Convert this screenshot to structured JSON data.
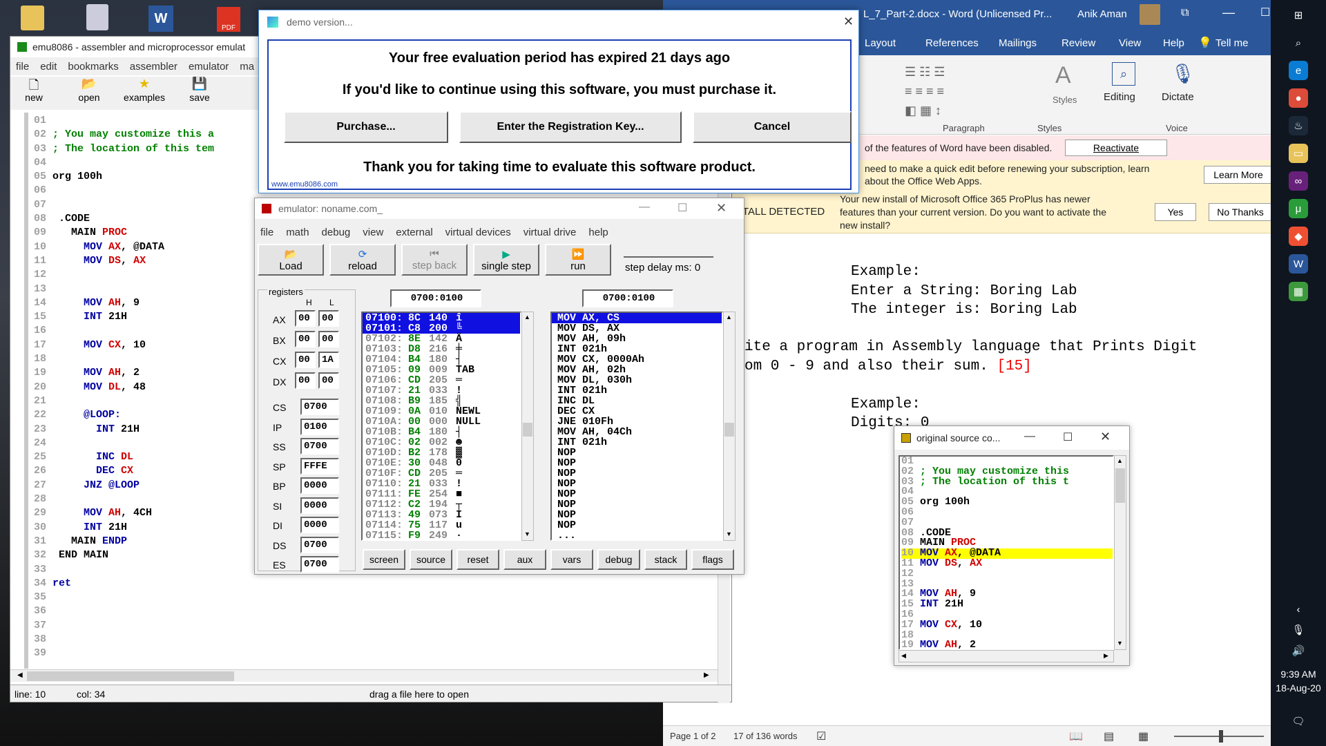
{
  "desktop": {
    "icons": [
      "recycle-bin",
      "word-doc",
      "pdf-file"
    ]
  },
  "word": {
    "title": "L_7_Part-2.docx - Word (Unlicensed Pr...",
    "user": "Anik Aman",
    "menu": [
      "Layout",
      "References",
      "Mailings",
      "Review",
      "View",
      "Help",
      "Tell me"
    ],
    "ribbon": {
      "paragraph": "Paragraph",
      "styles": "Styles",
      "styles_group": "Styles",
      "editing": "Editing",
      "dictate": "Dictate",
      "voice": "Voice"
    },
    "bar1": {
      "text": "of the features of Word have been disabled.",
      "button": "Reactivate"
    },
    "bar2": {
      "text1": "need to make a quick edit before renewing your subscription, learn",
      "text2": "about the Office Web Apps.",
      "button": "Learn More"
    },
    "bar3": {
      "label": "TALL DETECTED",
      "text1": "Your new install of Microsoft Office 365 ProPlus has newer",
      "text2": "features than your current version. Do you want to activate the",
      "text3": "new install?",
      "yes": "Yes",
      "no": "No Thanks"
    },
    "doc": {
      "l1": "Example:",
      "l2": "Enter a String: Boring Lab",
      "l3": "The integer is: Boring Lab",
      "l4": "ite a program in Assembly language that Prints Digit",
      "l5": "om 0 - 9 and also their sum. ",
      "l5b": "[15]",
      "l6": "Example:",
      "l7": "Digits: 0"
    },
    "status": {
      "page": "Page 1 of 2",
      "words": "17 of 136 words"
    }
  },
  "taskbar": {
    "time": "9:39 AM",
    "date": "18-Aug-20"
  },
  "emu": {
    "title": "emu8086 - assembler and microprocessor emulat",
    "menu": [
      "file",
      "edit",
      "bookmarks",
      "assembler",
      "emulator",
      "ma"
    ],
    "tools": [
      "new",
      "open",
      "examples",
      "save",
      "c"
    ],
    "status": {
      "line": "line: 10",
      "col": "col: 34",
      "drag": "drag a file here to open"
    },
    "code": [
      [
        {
          "t": "01",
          "c": "ln"
        }
      ],
      [
        {
          "t": "02 ",
          "c": "ln"
        },
        {
          "t": "; You may customize this a",
          "c": "cmt"
        }
      ],
      [
        {
          "t": "03 ",
          "c": "ln"
        },
        {
          "t": "; The location of this tem",
          "c": "cmt"
        }
      ],
      [
        {
          "t": "04",
          "c": "ln"
        }
      ],
      [
        {
          "t": "05 ",
          "c": "ln"
        },
        {
          "t": "org 100h",
          "c": "dir"
        }
      ],
      [
        {
          "t": "06",
          "c": "ln"
        }
      ],
      [
        {
          "t": "07",
          "c": "ln"
        }
      ],
      [
        {
          "t": "08 ",
          "c": "ln"
        },
        {
          "t": " .CODE",
          "c": "dir"
        }
      ],
      [
        {
          "t": "09 ",
          "c": "ln"
        },
        {
          "t": "   MAIN ",
          "c": "dir"
        },
        {
          "t": "PROC",
          "c": "reg"
        }
      ],
      [
        {
          "t": "10 ",
          "c": "ln"
        },
        {
          "t": "     MOV ",
          "c": "kw"
        },
        {
          "t": "AX",
          "c": "reg"
        },
        {
          "t": ", @DATA",
          "c": "dir"
        }
      ],
      [
        {
          "t": "11 ",
          "c": "ln"
        },
        {
          "t": "     MOV ",
          "c": "kw"
        },
        {
          "t": "DS",
          "c": "reg"
        },
        {
          "t": ", ",
          "c": "dir"
        },
        {
          "t": "AX",
          "c": "reg"
        }
      ],
      [
        {
          "t": "12",
          "c": "ln"
        }
      ],
      [
        {
          "t": "13",
          "c": "ln"
        }
      ],
      [
        {
          "t": "14 ",
          "c": "ln"
        },
        {
          "t": "     MOV ",
          "c": "kw"
        },
        {
          "t": "AH",
          "c": "reg"
        },
        {
          "t": ", 9",
          "c": "dir"
        }
      ],
      [
        {
          "t": "15 ",
          "c": "ln"
        },
        {
          "t": "     INT ",
          "c": "kw"
        },
        {
          "t": "21H",
          "c": "dir"
        }
      ],
      [
        {
          "t": "16",
          "c": "ln"
        }
      ],
      [
        {
          "t": "17 ",
          "c": "ln"
        },
        {
          "t": "     MOV ",
          "c": "kw"
        },
        {
          "t": "CX",
          "c": "reg"
        },
        {
          "t": ", 10",
          "c": "dir"
        }
      ],
      [
        {
          "t": "18",
          "c": "ln"
        }
      ],
      [
        {
          "t": "19 ",
          "c": "ln"
        },
        {
          "t": "     MOV ",
          "c": "kw"
        },
        {
          "t": "AH",
          "c": "reg"
        },
        {
          "t": ", 2",
          "c": "dir"
        }
      ],
      [
        {
          "t": "20 ",
          "c": "ln"
        },
        {
          "t": "     MOV ",
          "c": "kw"
        },
        {
          "t": "DL",
          "c": "reg"
        },
        {
          "t": ", 48",
          "c": "dir"
        }
      ],
      [
        {
          "t": "21",
          "c": "ln"
        }
      ],
      [
        {
          "t": "22 ",
          "c": "ln"
        },
        {
          "t": "     @LOOP:",
          "c": "kw"
        }
      ],
      [
        {
          "t": "23 ",
          "c": "ln"
        },
        {
          "t": "       INT ",
          "c": "kw"
        },
        {
          "t": "21H",
          "c": "dir"
        }
      ],
      [
        {
          "t": "24",
          "c": "ln"
        }
      ],
      [
        {
          "t": "25 ",
          "c": "ln"
        },
        {
          "t": "       INC ",
          "c": "kw"
        },
        {
          "t": "DL",
          "c": "reg"
        }
      ],
      [
        {
          "t": "26 ",
          "c": "ln"
        },
        {
          "t": "       DEC ",
          "c": "kw"
        },
        {
          "t": "CX",
          "c": "reg"
        }
      ],
      [
        {
          "t": "27 ",
          "c": "ln"
        },
        {
          "t": "     JNZ ",
          "c": "kw"
        },
        {
          "t": "@LOOP",
          "c": "kw"
        }
      ],
      [
        {
          "t": "28",
          "c": "ln"
        }
      ],
      [
        {
          "t": "29 ",
          "c": "ln"
        },
        {
          "t": "     MOV ",
          "c": "kw"
        },
        {
          "t": "AH",
          "c": "reg"
        },
        {
          "t": ", 4CH",
          "c": "dir"
        }
      ],
      [
        {
          "t": "30 ",
          "c": "ln"
        },
        {
          "t": "     INT ",
          "c": "kw"
        },
        {
          "t": "21H",
          "c": "dir"
        }
      ],
      [
        {
          "t": "31 ",
          "c": "ln"
        },
        {
          "t": "   MAIN ",
          "c": "dir"
        },
        {
          "t": "ENDP",
          "c": "kw"
        }
      ],
      [
        {
          "t": "32 ",
          "c": "ln"
        },
        {
          "t": " END MAIN",
          "c": "dir"
        }
      ],
      [
        {
          "t": "33",
          "c": "ln"
        }
      ],
      [
        {
          "t": "34 ",
          "c": "ln"
        },
        {
          "t": "ret",
          "c": "kw"
        }
      ],
      [
        {
          "t": "35",
          "c": "ln"
        }
      ],
      [
        {
          "t": "36",
          "c": "ln"
        }
      ],
      [
        {
          "t": "37",
          "c": "ln"
        }
      ],
      [
        {
          "t": "38",
          "c": "ln"
        }
      ],
      [
        {
          "t": "39",
          "c": "ln"
        }
      ]
    ]
  },
  "demo": {
    "title": "demo version...",
    "l1": "Your free evaluation period has expired 21 days ago",
    "l2": "If you'd like to continue using this software, you must purchase it.",
    "purchase": "Purchase...",
    "register": "Enter the Registration Key...",
    "cancel": "Cancel",
    "l3": "Thank you for taking time to evaluate this software product.",
    "url": "www.emu8086.com"
  },
  "emulator": {
    "title": "emulator: noname.com_",
    "menu": [
      "file",
      "math",
      "debug",
      "view",
      "external",
      "virtual devices",
      "virtual drive",
      "help"
    ],
    "tools": [
      "Load",
      "reload",
      "step back",
      "single step",
      "run"
    ],
    "step_delay": "step delay ms: 0",
    "registers_label": "registers",
    "h": "H",
    "l": "L",
    "addr1": "0700:0100",
    "addr2": "0700:0100",
    "regs8": [
      [
        "AX",
        "00",
        "00"
      ],
      [
        "BX",
        "00",
        "00"
      ],
      [
        "CX",
        "00",
        "1A"
      ],
      [
        "DX",
        "00",
        "00"
      ]
    ],
    "regs16": [
      [
        "CS",
        "0700"
      ],
      [
        "IP",
        "0100"
      ],
      [
        "SS",
        "0700"
      ],
      [
        "SP",
        "FFFE"
      ],
      [
        "BP",
        "0000"
      ],
      [
        "SI",
        "0000"
      ],
      [
        "DI",
        "0000"
      ],
      [
        "DS",
        "0700"
      ],
      [
        "ES",
        "0700"
      ]
    ],
    "mem": [
      [
        "07100:",
        "8C",
        "140",
        "î"
      ],
      [
        "07101:",
        "C8",
        "200",
        "╚"
      ],
      [
        "07102:",
        "8E",
        "142",
        "Ä"
      ],
      [
        "07103:",
        "D8",
        "216",
        "╪"
      ],
      [
        "07104:",
        "B4",
        "180",
        "┤"
      ],
      [
        "07105:",
        "09",
        "009",
        "TAB"
      ],
      [
        "07106:",
        "CD",
        "205",
        "═"
      ],
      [
        "07107:",
        "21",
        "033",
        "!"
      ],
      [
        "07108:",
        "B9",
        "185",
        "╣"
      ],
      [
        "07109:",
        "0A",
        "010",
        "NEWL"
      ],
      [
        "0710A:",
        "00",
        "000",
        "NULL"
      ],
      [
        "0710B:",
        "B4",
        "180",
        "┤"
      ],
      [
        "0710C:",
        "02",
        "002",
        "☻"
      ],
      [
        "0710D:",
        "B2",
        "178",
        "▓"
      ],
      [
        "0710E:",
        "30",
        "048",
        "0"
      ],
      [
        "0710F:",
        "CD",
        "205",
        "═"
      ],
      [
        "07110:",
        "21",
        "033",
        "!"
      ],
      [
        "07111:",
        "FE",
        "254",
        "■"
      ],
      [
        "07112:",
        "C2",
        "194",
        "┬"
      ],
      [
        "07113:",
        "49",
        "073",
        "I"
      ],
      [
        "07114:",
        "75",
        "117",
        "u"
      ],
      [
        "07115:",
        "F9",
        "249",
        "·"
      ]
    ],
    "dis": [
      "MOV AX, CS",
      "MOV DS, AX",
      "MOV AH, 09h",
      "INT 021h",
      "MOV CX, 0000Ah",
      "MOV AH, 02h",
      "MOV DL, 030h",
      "INT 021h",
      "INC DL",
      "DEC CX",
      "JNE 010Fh",
      "MOV AH, 04Ch",
      "INT 021h",
      "NOP",
      "NOP",
      "NOP",
      "NOP",
      "NOP",
      "NOP",
      "NOP",
      "NOP",
      "..."
    ],
    "bottom": [
      "screen",
      "source",
      "reset",
      "aux",
      "vars",
      "debug",
      "stack",
      "flags"
    ]
  },
  "src": {
    "title": "original source co...",
    "code": [
      [
        {
          "t": "01",
          "c": "ln"
        }
      ],
      [
        {
          "t": "02 ",
          "c": "ln"
        },
        {
          "t": "; You may customize this",
          "c": "cmt"
        }
      ],
      [
        {
          "t": "03 ",
          "c": "ln"
        },
        {
          "t": "; The location of this t",
          "c": "cmt"
        }
      ],
      [
        {
          "t": "04",
          "c": "ln"
        }
      ],
      [
        {
          "t": "05 ",
          "c": "ln"
        },
        {
          "t": "org 100h",
          "c": "dir"
        }
      ],
      [
        {
          "t": "06",
          "c": "ln"
        }
      ],
      [
        {
          "t": "07",
          "c": "ln"
        }
      ],
      [
        {
          "t": "08 ",
          "c": "ln"
        },
        {
          "t": ".CODE",
          "c": "dir"
        }
      ],
      [
        {
          "t": "09 ",
          "c": "ln"
        },
        {
          "t": "MAIN ",
          "c": "dir"
        },
        {
          "t": "PROC",
          "c": "reg"
        }
      ],
      [
        {
          "t": "10 ",
          "c": "ln"
        },
        {
          "t": "MOV ",
          "c": "kw"
        },
        {
          "t": "AX",
          "c": "reg"
        },
        {
          "t": ", @DATA",
          "c": "dir"
        }
      ],
      [
        {
          "t": "11 ",
          "c": "ln"
        },
        {
          "t": "MOV ",
          "c": "kw"
        },
        {
          "t": "DS",
          "c": "reg"
        },
        {
          "t": ", ",
          "c": "dir"
        },
        {
          "t": "AX",
          "c": "reg"
        }
      ],
      [
        {
          "t": "12",
          "c": "ln"
        }
      ],
      [
        {
          "t": "13",
          "c": "ln"
        }
      ],
      [
        {
          "t": "14 ",
          "c": "ln"
        },
        {
          "t": "MOV ",
          "c": "kw"
        },
        {
          "t": "AH",
          "c": "reg"
        },
        {
          "t": ", 9",
          "c": "dir"
        }
      ],
      [
        {
          "t": "15 ",
          "c": "ln"
        },
        {
          "t": "INT ",
          "c": "kw"
        },
        {
          "t": "21H",
          "c": "dir"
        }
      ],
      [
        {
          "t": "16",
          "c": "ln"
        }
      ],
      [
        {
          "t": "17 ",
          "c": "ln"
        },
        {
          "t": "MOV ",
          "c": "kw"
        },
        {
          "t": "CX",
          "c": "reg"
        },
        {
          "t": ", 10",
          "c": "dir"
        }
      ],
      [
        {
          "t": "18",
          "c": "ln"
        }
      ],
      [
        {
          "t": "19 ",
          "c": "ln"
        },
        {
          "t": "MOV ",
          "c": "kw"
        },
        {
          "t": "AH",
          "c": "reg"
        },
        {
          "t": ", 2",
          "c": "dir"
        }
      ]
    ]
  }
}
